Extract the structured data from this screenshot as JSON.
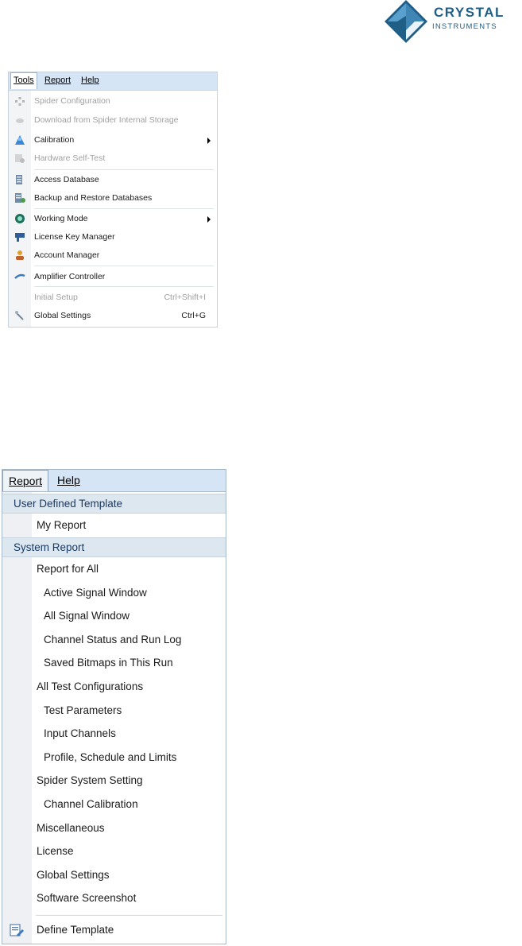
{
  "logo": {
    "name": "CRYSTAL",
    "sub": "INSTRUMENTS"
  },
  "tools_menu": {
    "bar": [
      "Tools",
      "Report",
      "Help"
    ],
    "items": [
      {
        "label": "Spider Configuration",
        "disabled": true,
        "icon": "spider-icon"
      },
      {
        "label": "Download from Spider Internal Storage",
        "disabled": true,
        "icon": "download-icon"
      },
      {
        "label": "Calibration",
        "disabled": false,
        "submenu": true,
        "icon": "calibration-icon"
      },
      {
        "label": "Hardware Self-Test",
        "disabled": true,
        "icon": "self-test-icon"
      },
      {
        "label": "Access Database",
        "disabled": false,
        "icon": "database-icon"
      },
      {
        "label": "Backup and Restore Databases",
        "disabled": false,
        "icon": "backup-icon"
      },
      {
        "label": "Working Mode",
        "disabled": false,
        "submenu": true,
        "icon": "working-mode-icon"
      },
      {
        "label": "License Key Manager",
        "disabled": false,
        "icon": "license-key-icon"
      },
      {
        "label": "Account Manager",
        "disabled": false,
        "icon": "account-icon"
      },
      {
        "label": "Amplifier Controller",
        "disabled": false,
        "icon": "amplifier-icon"
      },
      {
        "label": "Initial Setup",
        "shortcut": "Ctrl+Shift+I",
        "disabled": true,
        "icon": "initial-setup-icon"
      },
      {
        "label": "Global Settings",
        "shortcut": "Ctrl+G",
        "disabled": false,
        "icon": "wrench-icon"
      }
    ]
  },
  "report_menu": {
    "bar": [
      "Report",
      "Help"
    ],
    "group1": "User Defined Template",
    "my_report": "My Report",
    "group2": "System Report",
    "items": [
      {
        "label": "Report for All",
        "level": 0
      },
      {
        "label": "Active Signal Window",
        "level": 1
      },
      {
        "label": "All Signal Window",
        "level": 1
      },
      {
        "label": "Channel Status and Run Log",
        "level": 1
      },
      {
        "label": "Saved Bitmaps in This Run",
        "level": 1
      },
      {
        "label": "All Test Configurations",
        "level": 0
      },
      {
        "label": "Test Parameters",
        "level": 1
      },
      {
        "label": "Input Channels",
        "level": 1
      },
      {
        "label": "Profile, Schedule and Limits",
        "level": 1
      },
      {
        "label": "Spider System Setting",
        "level": 0
      },
      {
        "label": "Channel Calibration",
        "level": 1
      },
      {
        "label": "Miscellaneous",
        "level": 0
      },
      {
        "label": "License",
        "level": 0
      },
      {
        "label": "Global Settings",
        "level": 0
      },
      {
        "label": "Software Screenshot",
        "level": 0
      }
    ],
    "define_template": "Define Template"
  }
}
